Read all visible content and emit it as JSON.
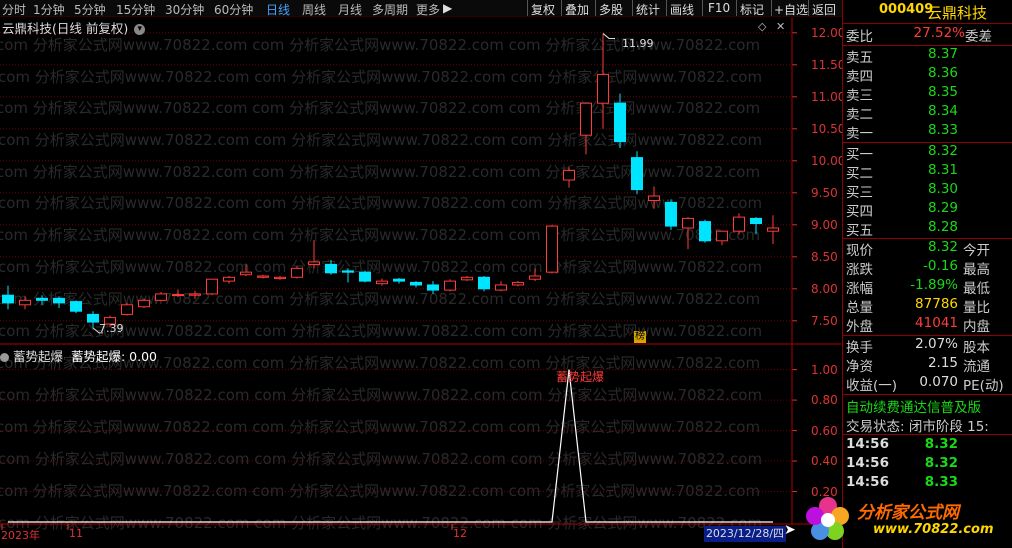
{
  "toolbar": {
    "periods": [
      "分时",
      "1分钟",
      "5分钟",
      "15分钟",
      "30分钟",
      "60分钟",
      "日线",
      "周线",
      "月线",
      "多周期",
      "更多"
    ],
    "more_arrow": "▶",
    "right_buttons": [
      "复权",
      "叠加",
      "多股",
      "统计",
      "画线",
      "F10",
      "标记",
      "+自选",
      "返回"
    ]
  },
  "chart": {
    "title": "云鼎科技(日线 前复权)",
    "indicator_title": "蓄势起爆",
    "indicator_value_text": "蓄势起爆: 0.00",
    "signal_label": "蓄势起爆",
    "high_label": "11.99",
    "low_label": "7.39",
    "marker_label": "榜",
    "x_labels": [
      "2023年",
      "11",
      "12"
    ],
    "date_box": "2023/12/28/四",
    "watermark": "com 分析家公式网www.70822.com"
  },
  "chart_data": [
    {
      "type": "candlestick",
      "title": "云鼎科技(日线 前复权)",
      "y_ticks": [
        7.5,
        8.0,
        8.5,
        9.0,
        9.5,
        10.0,
        10.5,
        11.0,
        11.5,
        12.0
      ],
      "ylim": [
        7.2,
        12.2
      ],
      "colors": {
        "up": "#ff3b3b",
        "down": "#00e5ff"
      },
      "ohlc": [
        [
          7.9,
          8.05,
          7.68,
          7.78
        ],
        [
          7.75,
          7.88,
          7.68,
          7.82
        ],
        [
          7.85,
          7.9,
          7.75,
          7.82
        ],
        [
          7.85,
          7.88,
          7.7,
          7.78
        ],
        [
          7.8,
          7.82,
          7.62,
          7.65
        ],
        [
          7.6,
          7.65,
          7.39,
          7.48
        ],
        [
          7.45,
          7.58,
          7.4,
          7.55
        ],
        [
          7.6,
          7.78,
          7.58,
          7.75
        ],
        [
          7.72,
          7.85,
          7.7,
          7.82
        ],
        [
          7.82,
          7.95,
          7.8,
          7.92
        ],
        [
          7.9,
          7.99,
          7.87,
          7.91
        ],
        [
          7.9,
          7.97,
          7.84,
          7.92
        ],
        [
          7.92,
          8.15,
          7.9,
          8.15
        ],
        [
          8.12,
          8.2,
          8.08,
          8.18
        ],
        [
          8.22,
          8.38,
          8.2,
          8.26
        ],
        [
          8.18,
          8.22,
          8.16,
          8.2
        ],
        [
          8.16,
          8.2,
          8.14,
          8.18
        ],
        [
          8.18,
          8.35,
          8.16,
          8.32
        ],
        [
          8.38,
          8.76,
          8.32,
          8.42
        ],
        [
          8.38,
          8.45,
          8.22,
          8.25
        ],
        [
          8.28,
          8.32,
          8.1,
          8.26
        ],
        [
          8.26,
          8.28,
          8.1,
          8.12
        ],
        [
          8.08,
          8.16,
          8.05,
          8.12
        ],
        [
          8.15,
          8.17,
          8.08,
          8.12
        ],
        [
          8.1,
          8.12,
          8.02,
          8.06
        ],
        [
          8.06,
          8.12,
          7.92,
          7.98
        ],
        [
          7.98,
          8.15,
          7.96,
          8.12
        ],
        [
          8.14,
          8.2,
          8.12,
          8.18
        ],
        [
          8.18,
          8.2,
          7.96,
          8.0
        ],
        [
          7.98,
          8.12,
          7.96,
          8.06
        ],
        [
          8.06,
          8.12,
          8.04,
          8.1
        ],
        [
          8.15,
          8.32,
          8.12,
          8.2
        ],
        [
          8.26,
          9.0,
          8.24,
          8.98
        ],
        [
          9.7,
          9.9,
          9.58,
          9.85
        ],
        [
          10.4,
          10.62,
          10.1,
          10.9
        ],
        [
          10.9,
          11.99,
          10.5,
          11.35
        ],
        [
          10.9,
          11.05,
          10.2,
          10.3
        ],
        [
          10.05,
          10.15,
          9.48,
          9.55
        ],
        [
          9.38,
          9.6,
          9.25,
          9.45
        ],
        [
          9.35,
          9.4,
          8.92,
          8.98
        ],
        [
          8.95,
          9.12,
          8.62,
          9.1
        ],
        [
          9.05,
          9.08,
          8.72,
          8.75
        ],
        [
          8.75,
          8.9,
          8.68,
          8.9
        ],
        [
          8.9,
          9.18,
          8.85,
          9.12
        ],
        [
          9.1,
          9.12,
          8.85,
          9.02
        ],
        [
          8.9,
          9.15,
          8.7,
          8.95
        ]
      ]
    },
    {
      "type": "line",
      "title": "蓄势起爆",
      "y_ticks": [
        0.2,
        0.4,
        0.6,
        0.8,
        1.0
      ],
      "ylim": [
        0,
        1.05
      ],
      "series": [
        {
          "name": "蓄势起爆",
          "values": [
            0,
            0,
            0,
            0,
            0,
            0,
            0,
            0,
            0,
            0,
            0,
            0,
            0,
            0,
            0,
            0,
            0,
            0,
            0,
            0,
            0,
            0,
            0,
            0,
            0,
            0,
            0,
            0,
            0,
            0,
            0,
            0,
            0,
            1,
            0,
            0,
            0,
            0,
            0,
            0,
            0,
            0,
            0,
            0,
            0,
            0
          ]
        }
      ]
    }
  ],
  "quote": {
    "code": "000409",
    "name": "云鼎科技",
    "ratio_label": "委比",
    "ratio_value": "27.52%",
    "ratio_diff_label": "委差",
    "asks": [
      {
        "label": "卖五",
        "price": "8.37"
      },
      {
        "label": "卖四",
        "price": "8.36"
      },
      {
        "label": "卖三",
        "price": "8.35"
      },
      {
        "label": "卖二",
        "price": "8.34"
      },
      {
        "label": "卖一",
        "price": "8.33"
      }
    ],
    "bids": [
      {
        "label": "买一",
        "price": "8.32"
      },
      {
        "label": "买二",
        "price": "8.31"
      },
      {
        "label": "买三",
        "price": "8.30"
      },
      {
        "label": "买四",
        "price": "8.29"
      },
      {
        "label": "买五",
        "price": "8.28"
      }
    ],
    "stats": [
      {
        "label": "现价",
        "value": "8.32",
        "label2": "今开",
        "color": "green"
      },
      {
        "label": "涨跌",
        "value": "-0.16",
        "label2": "最高",
        "color": "green"
      },
      {
        "label": "涨幅",
        "value": "-1.89%",
        "label2": "最低",
        "color": "green"
      },
      {
        "label": "总量",
        "value": "87786",
        "label2": "量比",
        "color": "yellow"
      },
      {
        "label": "外盘",
        "value": "41041",
        "label2": "内盘",
        "color": "red"
      }
    ],
    "stats2": [
      {
        "label": "换手",
        "value": "2.07%",
        "label2": "股本"
      },
      {
        "label": "净资",
        "value": "2.15",
        "label2": "流通"
      },
      {
        "label": "收益(一)",
        "value": "0.070",
        "label2": "PE(动)"
      }
    ],
    "notice": "自动续费通达信普及版",
    "trade_status": "交易状态: 闭市阶段 15:",
    "ticks": [
      {
        "time": "14:56",
        "price": "8.32"
      },
      {
        "time": "14:56",
        "price": "8.32"
      },
      {
        "time": "14:56",
        "price": "8.33"
      }
    ],
    "logo_text": "分析家公式网",
    "logo_url": "www.70822.com"
  },
  "colors": {
    "up": "#ff3b3b",
    "down": "#00e5ff",
    "grid": "#6b0000",
    "axis": "#d33",
    "bg": "#000000"
  }
}
